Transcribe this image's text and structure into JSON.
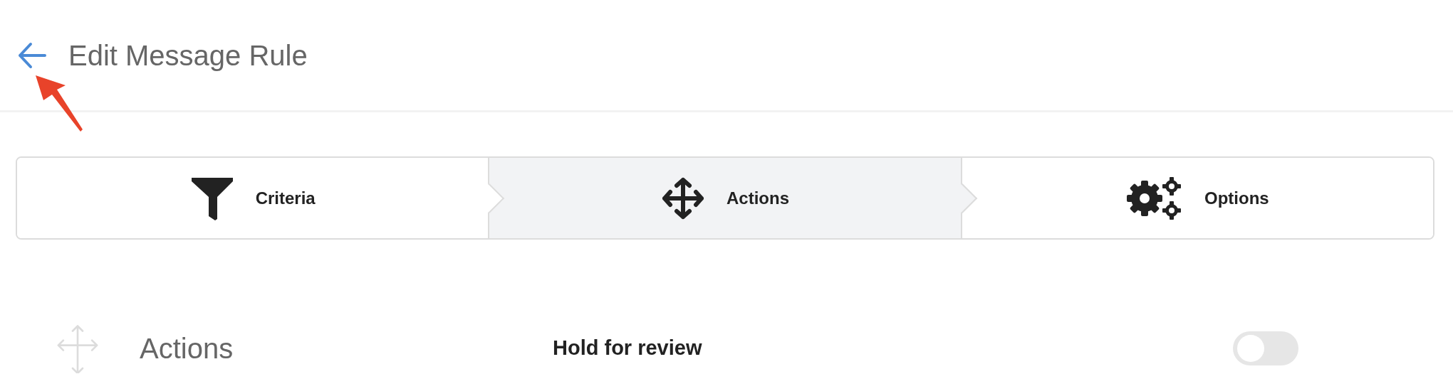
{
  "header": {
    "title": "Edit Message Rule"
  },
  "steps": [
    {
      "label": "Criteria",
      "kind": "funnel",
      "selected": false
    },
    {
      "label": "Actions",
      "kind": "move",
      "selected": true
    },
    {
      "label": "Options",
      "kind": "gears",
      "selected": false
    }
  ],
  "section": {
    "title": "Actions"
  },
  "settings": [
    {
      "label": "Hold for review",
      "on": false
    }
  ]
}
